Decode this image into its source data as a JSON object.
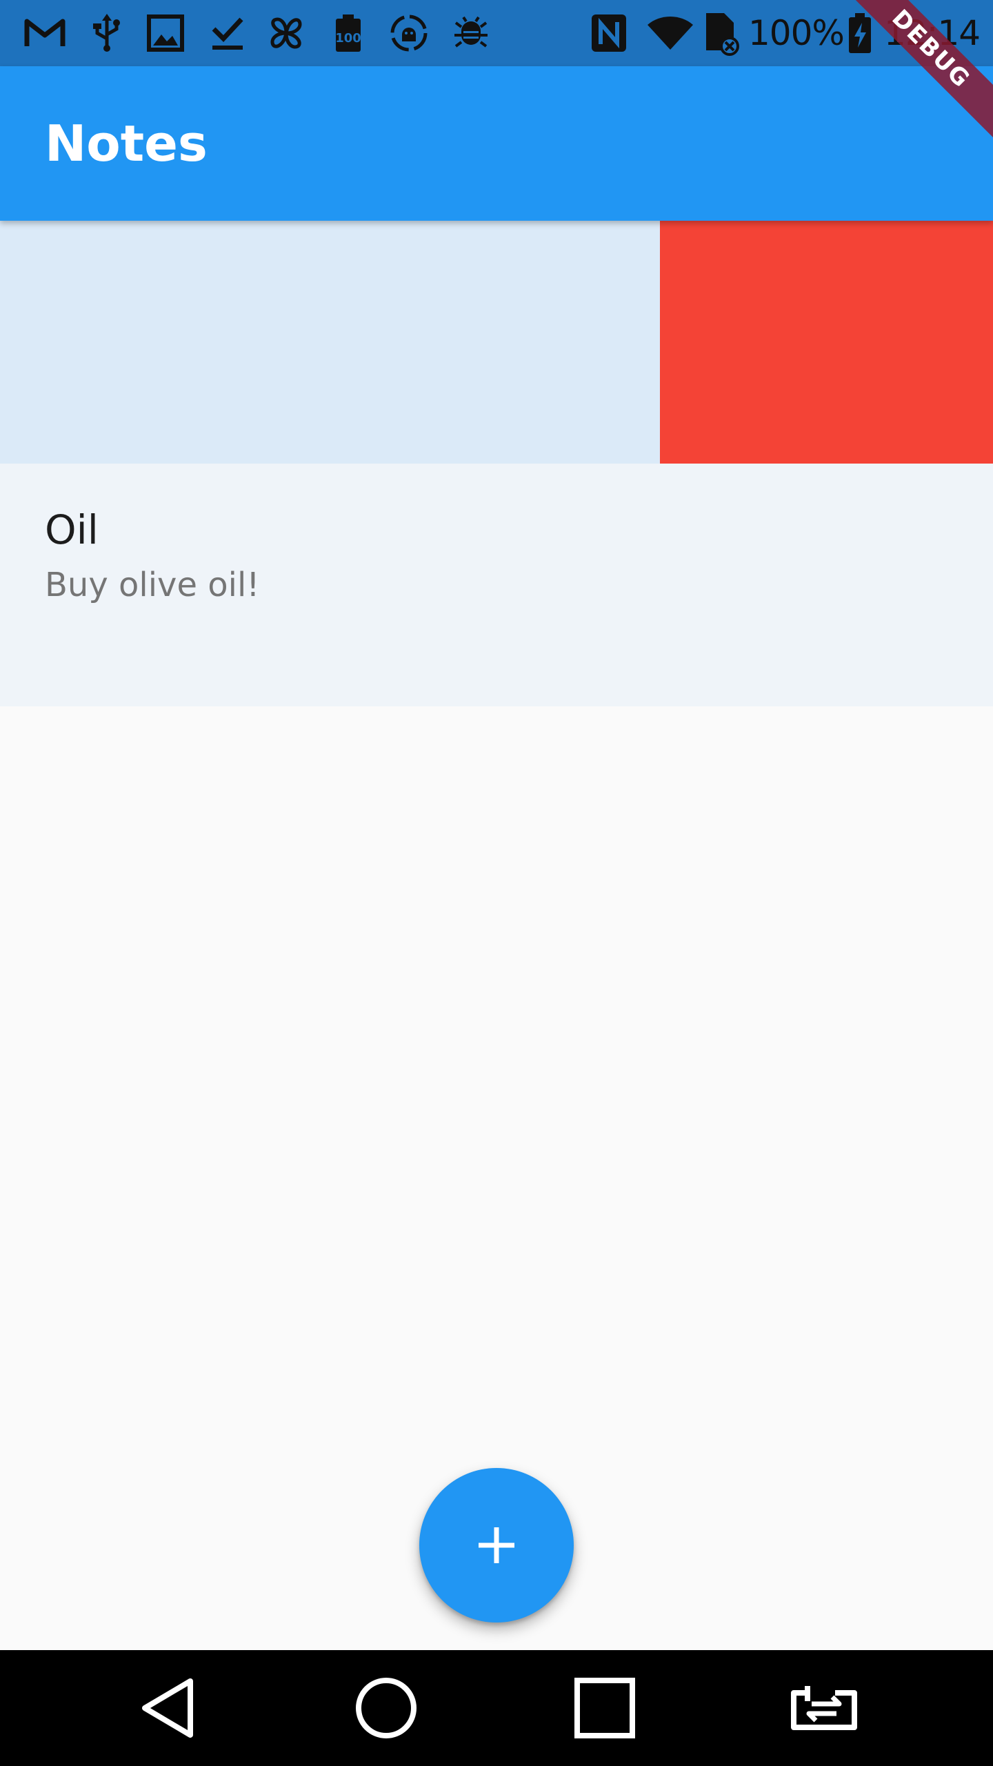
{
  "status_bar": {
    "icons": [
      "gmail-icon",
      "usb-icon",
      "image-icon",
      "download-done-icon",
      "pinwheel-icon",
      "battery-100-icon",
      "android-sync-icon",
      "bug-icon",
      "nfc-icon",
      "wifi-icon",
      "sim-off-icon",
      "battery-charging-icon"
    ],
    "battery_percent": "100%",
    "time": "12:14"
  },
  "debug_banner": "DEBUG",
  "app_bar": {
    "title": "Notes"
  },
  "notes": [
    {
      "title": "",
      "body": "",
      "state": "swiped"
    },
    {
      "title": "Oil",
      "body": "Buy olive oil!"
    }
  ],
  "fab": {
    "icon": "plus-icon"
  },
  "nav_bar": {
    "buttons": [
      "back-icon",
      "home-icon",
      "recents-icon",
      "rotate-icon"
    ]
  },
  "colors": {
    "status_bar": "#1e72bd",
    "primary": "#2196f3",
    "delete_background": "#f44336",
    "swiped_item": "#dbeaf8",
    "list_item": "#eff4f9",
    "background": "#fafafa",
    "debug_ribbon": "#8a1a30"
  }
}
